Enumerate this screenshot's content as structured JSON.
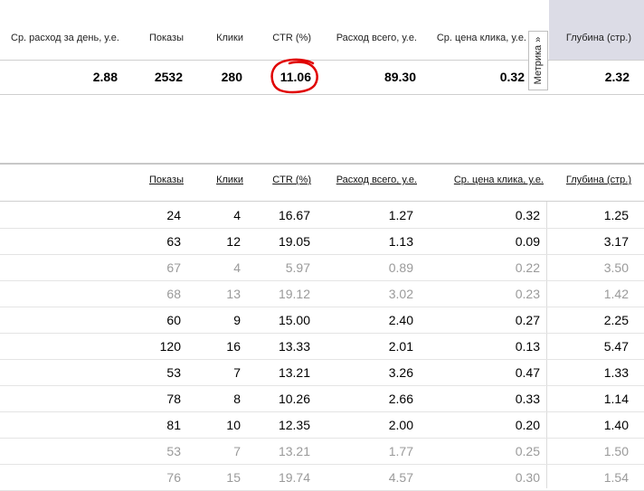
{
  "summary_header": {
    "daily_spend": "Ср. расход за день, у.е.",
    "impressions": "Показы",
    "clicks": "Клики",
    "ctr": "CTR (%)",
    "total_spend": "Расход всего, у.е.",
    "avg_cpc": "Ср. цена клика, у.е.",
    "depth": "Глубина (стр.)"
  },
  "summary_values": {
    "daily_spend": "2.88",
    "impressions": "2532",
    "clicks": "280",
    "ctr": "11.06",
    "total_spend": "89.30",
    "avg_cpc": "0.32",
    "depth": "2.32"
  },
  "metrika_tab": {
    "label": "Метрика »"
  },
  "detail_header": {
    "impressions": "Показы",
    "clicks": "Клики",
    "ctr": "CTR (%)",
    "total_spend": "Расход всего, у.е.",
    "avg_cpc": "Ср. цена клика, у.е.",
    "depth": "Глубина (стр.)"
  },
  "rows": [
    {
      "impressions": "24",
      "clicks": "4",
      "ctr": "16.67",
      "total_spend": "1.27",
      "avg_cpc": "0.32",
      "depth": "1.25",
      "dim": false
    },
    {
      "impressions": "63",
      "clicks": "12",
      "ctr": "19.05",
      "total_spend": "1.13",
      "avg_cpc": "0.09",
      "depth": "3.17",
      "dim": false
    },
    {
      "impressions": "67",
      "clicks": "4",
      "ctr": "5.97",
      "total_spend": "0.89",
      "avg_cpc": "0.22",
      "depth": "3.50",
      "dim": true
    },
    {
      "impressions": "68",
      "clicks": "13",
      "ctr": "19.12",
      "total_spend": "3.02",
      "avg_cpc": "0.23",
      "depth": "1.42",
      "dim": true
    },
    {
      "impressions": "60",
      "clicks": "9",
      "ctr": "15.00",
      "total_spend": "2.40",
      "avg_cpc": "0.27",
      "depth": "2.25",
      "dim": false
    },
    {
      "impressions": "120",
      "clicks": "16",
      "ctr": "13.33",
      "total_spend": "2.01",
      "avg_cpc": "0.13",
      "depth": "5.47",
      "dim": false
    },
    {
      "impressions": "53",
      "clicks": "7",
      "ctr": "13.21",
      "total_spend": "3.26",
      "avg_cpc": "0.47",
      "depth": "1.33",
      "dim": false
    },
    {
      "impressions": "78",
      "clicks": "8",
      "ctr": "10.26",
      "total_spend": "2.66",
      "avg_cpc": "0.33",
      "depth": "1.14",
      "dim": false
    },
    {
      "impressions": "81",
      "clicks": "10",
      "ctr": "12.35",
      "total_spend": "2.00",
      "avg_cpc": "0.20",
      "depth": "1.40",
      "dim": false
    },
    {
      "impressions": "53",
      "clicks": "7",
      "ctr": "13.21",
      "total_spend": "1.77",
      "avg_cpc": "0.25",
      "depth": "1.50",
      "dim": true
    },
    {
      "impressions": "76",
      "clicks": "15",
      "ctr": "19.74",
      "total_spend": "4.57",
      "avg_cpc": "0.30",
      "depth": "1.54",
      "dim": true
    }
  ],
  "colors": {
    "depth_header_bg": "#dcdce6",
    "annotation": "#e00000",
    "dim_text": "#9a9a9a"
  }
}
